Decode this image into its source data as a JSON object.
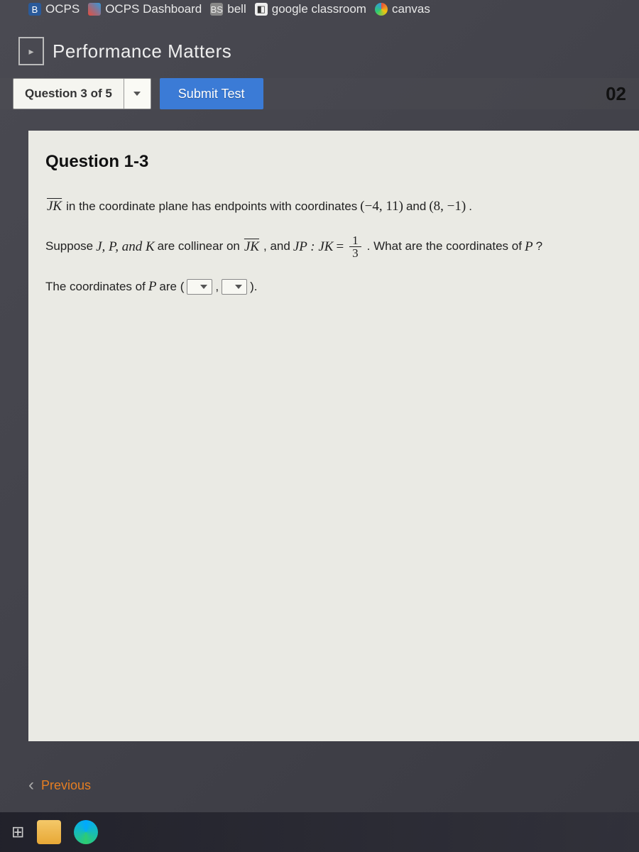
{
  "bookmarks": {
    "items": [
      {
        "label": "OCPS"
      },
      {
        "label": "OCPS Dashboard"
      },
      {
        "label": "bell"
      },
      {
        "label": "google classroom"
      },
      {
        "label": "canvas"
      }
    ]
  },
  "header": {
    "title": "Performance Matters"
  },
  "toolbar": {
    "question_label": "Question 3 of 5",
    "submit_label": "Submit Test",
    "timer": "02"
  },
  "question": {
    "heading": "Question 1-3",
    "line1": {
      "seg": "JK",
      "text1": " in the coordinate plane has endpoints with coordinates ",
      "pt1": "(−4, 11)",
      "text2": " and ",
      "pt2": "(8, −1)",
      "text3": "."
    },
    "line2": {
      "text1": "Suppose ",
      "vars": "J, P, and K",
      "text2": " are collinear on ",
      "seg": "JK",
      "text3": ", and ",
      "ratio_lhs": "JP : JK",
      "equals": " = ",
      "frac_num": "1",
      "frac_den": "3",
      "text4": ". What are the coordinates of ",
      "var_p": "P",
      "text5": "?"
    },
    "line3": {
      "text1": "The coordinates of ",
      "var_p": "P",
      "text2": " are (",
      "comma": ",",
      "close": ")."
    }
  },
  "nav": {
    "previous": "Previous"
  }
}
